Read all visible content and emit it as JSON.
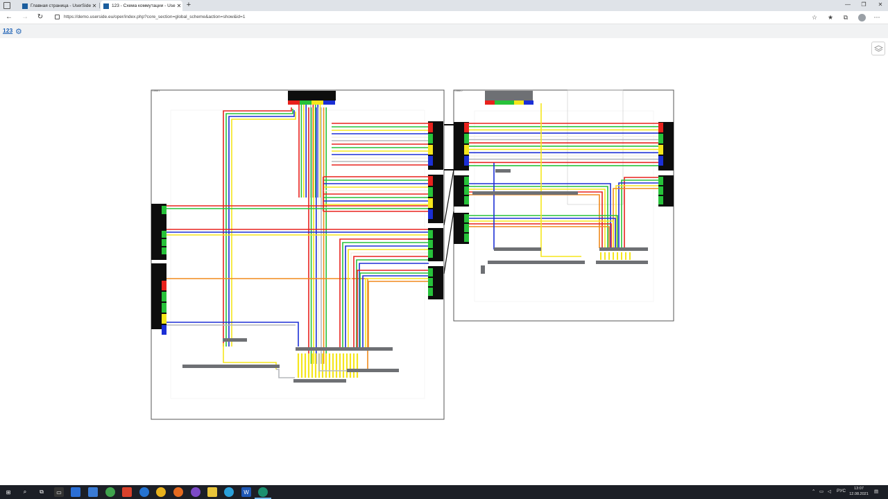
{
  "browser": {
    "tabs": [
      {
        "title": "Главная страница - UserSide",
        "active": false
      },
      {
        "title": "123 - Схема коммутации - Use",
        "active": true
      }
    ],
    "url": "https://demo.userside.eu/oper/index.php?core_section=global_scheme&action=show&id=1"
  },
  "app": {
    "scheme_id_label": "123"
  },
  "schemes": [
    {
      "name": "Схема 1"
    },
    {
      "name": "Схема 2"
    }
  ],
  "colors": {
    "red": "#e8221d",
    "green": "#27c23a",
    "yellow": "#f5e61c",
    "blue": "#1b2fd6",
    "orange": "#f08a1c",
    "grey": "#b5b8bc",
    "white": "#f4f1e6",
    "black": "#0d0d0d",
    "device": "#6e7074"
  },
  "taskbar": {
    "tray_lang": "РУС",
    "time": "13:07",
    "date": "12.08.2021"
  }
}
